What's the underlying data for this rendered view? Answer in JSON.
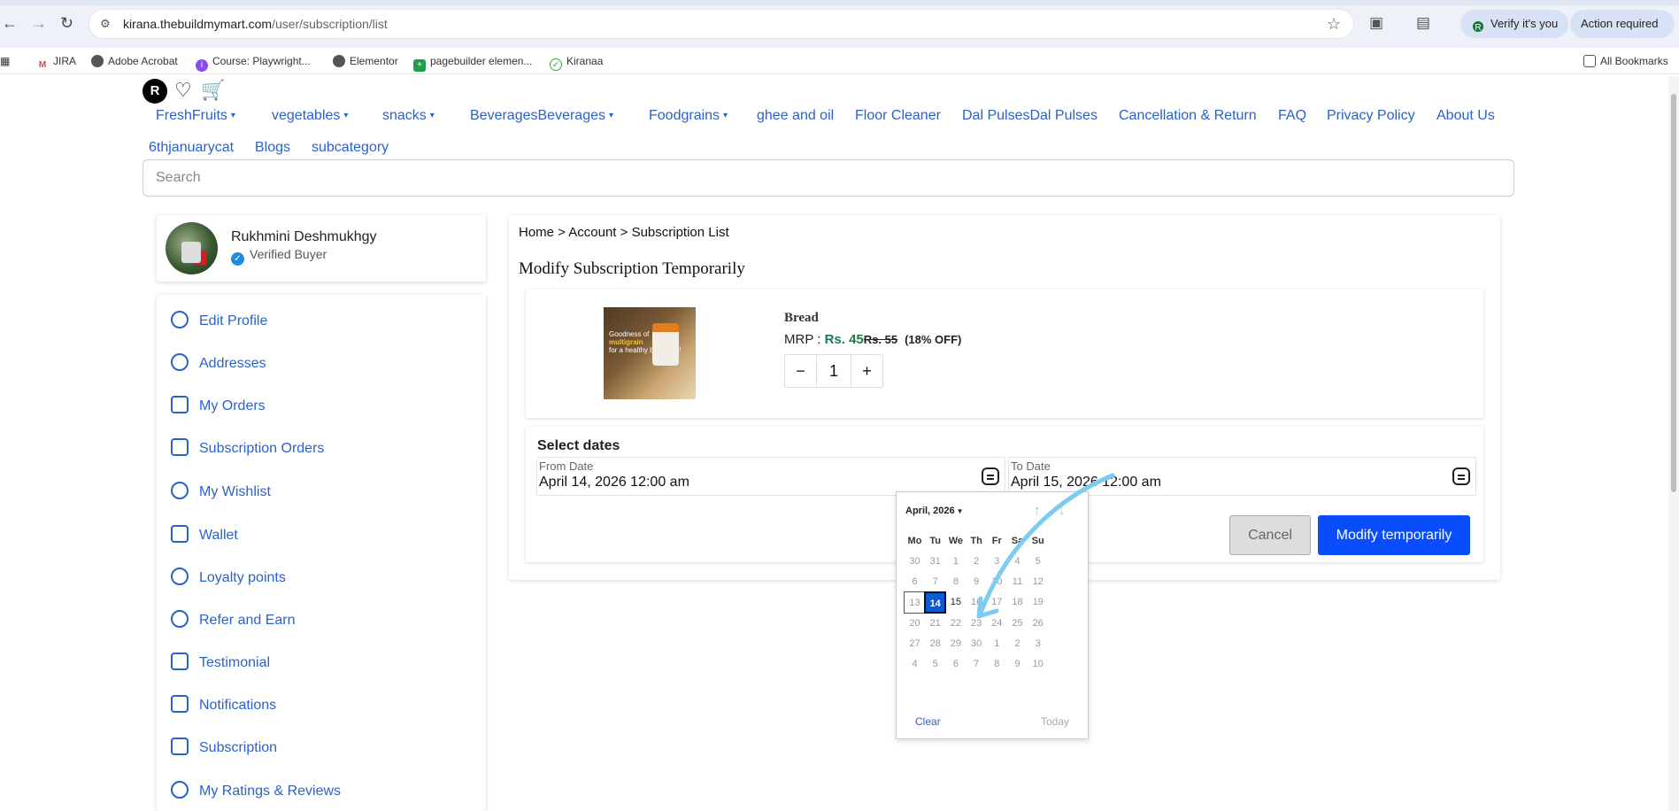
{
  "browser": {
    "url_host": "kirana.thebuildmymart.com",
    "url_path": "/user/subscription/list",
    "profile_chip_initial": "R",
    "profile_chip_label": "Verify it's you",
    "action_chip_label": "Action required",
    "bookmarks": [
      "JIRA",
      "Adobe Acrobat",
      "Course: Playwright...",
      "Elementor",
      "pagebuilder elemen...",
      "Kiranaa"
    ],
    "all_bookmarks": "All Bookmarks"
  },
  "header": {
    "avatar_initial": "R",
    "menu": [
      {
        "label": "FreshFruits",
        "caret": true
      },
      {
        "label": "vegetables",
        "caret": true
      },
      {
        "label": "snacks",
        "caret": true
      },
      {
        "label": "BeveragesBeverages",
        "caret": true
      },
      {
        "label": "Foodgrains",
        "caret": true
      },
      {
        "label": "ghee and oil",
        "caret": false
      },
      {
        "label": "Floor Cleaner",
        "caret": false
      },
      {
        "label": "Dal PulsesDal Pulses",
        "caret": false
      },
      {
        "label": "Cancellation & Return",
        "caret": false
      },
      {
        "label": "FAQ",
        "caret": false
      },
      {
        "label": "Privacy Policy",
        "caret": false
      },
      {
        "label": "About Us",
        "caret": false
      },
      {
        "label": "6thjanuarycat",
        "caret": false
      },
      {
        "label": "Blogs",
        "caret": false
      },
      {
        "label": "subcategory",
        "caret": false
      }
    ],
    "search_placeholder": "Search"
  },
  "profile": {
    "name": "Rukhmini Deshmukhgy",
    "status": "Verified Buyer"
  },
  "sidebar": {
    "items": [
      {
        "label": "Edit Profile",
        "icon": "user-icon"
      },
      {
        "label": "Addresses",
        "icon": "location-pin-icon"
      },
      {
        "label": "My Orders",
        "icon": "orders-icon"
      },
      {
        "label": "Subscription Orders",
        "icon": "subscription-orders-icon"
      },
      {
        "label": "My Wishlist",
        "icon": "heart-icon"
      },
      {
        "label": "Wallet",
        "icon": "wallet-icon"
      },
      {
        "label": "Loyalty points",
        "icon": "coins-icon"
      },
      {
        "label": "Refer and Earn",
        "icon": "refer-icon"
      },
      {
        "label": "Testimonial",
        "icon": "quote-icon"
      },
      {
        "label": "Notifications",
        "icon": "mail-notification-icon"
      },
      {
        "label": "Subscription",
        "icon": "subscription-icon"
      },
      {
        "label": "My Ratings & Reviews",
        "icon": "star-icon"
      }
    ]
  },
  "main": {
    "breadcrumb": "Home > Account > Subscription List",
    "title": "Modify Subscription Temporarily",
    "product": {
      "name": "Bread",
      "mrp_label": "MRP : ",
      "price": "Rs. 45",
      "old_price": "Rs. 55",
      "discount": "(18% OFF)",
      "quantity": "1",
      "image_text_1": "Goodness of",
      "image_text_2": "multigrain",
      "image_text_3": "for a healthy breakfast!"
    },
    "dates": {
      "title": "Select dates",
      "from_label": "From Date",
      "from_value": "April 14, 2026 12:00 am",
      "to_label": "To Date",
      "to_value": "April 15, 2026 12:00 am"
    },
    "cancel_label": "Cancel",
    "modify_label": "Modify temporarily"
  },
  "datepicker": {
    "month_label": "April, 2026",
    "weekdays": [
      "Mo",
      "Tu",
      "We",
      "Th",
      "Fr",
      "Sa",
      "Su"
    ],
    "weeks": [
      [
        "30",
        "31",
        "1",
        "2",
        "3",
        "4",
        "5"
      ],
      [
        "6",
        "7",
        "8",
        "9",
        "10",
        "11",
        "12"
      ],
      [
        "13",
        "14",
        "15",
        "16",
        "17",
        "18",
        "19"
      ],
      [
        "20",
        "21",
        "22",
        "23",
        "24",
        "25",
        "26"
      ],
      [
        "27",
        "28",
        "29",
        "30",
        "1",
        "2",
        "3"
      ],
      [
        "4",
        "5",
        "6",
        "7",
        "8",
        "9",
        "10"
      ]
    ],
    "selected_day": "14",
    "outlined_day": "13",
    "enabled_day": "15",
    "clear_label": "Clear",
    "today_label": "Today"
  },
  "colors": {
    "link_blue": "#2a62c9",
    "primary_button": "#0a4dff",
    "price_green": "#1f7a4b",
    "annotation_arrow": "#7ccbf2"
  }
}
